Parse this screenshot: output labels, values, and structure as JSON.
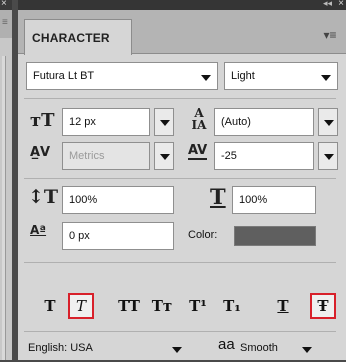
{
  "panel": {
    "tab_label": "CHARACTER",
    "collapse_glyph": "◂◂",
    "close_glyph": "×",
    "menu_glyph": "▾≡"
  },
  "font": {
    "family": "Futura Lt BT",
    "style": "Light"
  },
  "size": {
    "value": "12 px",
    "leading": "(Auto)"
  },
  "kerning": {
    "value": "Metrics",
    "tracking": "-25"
  },
  "scale": {
    "vertical": "100%",
    "horizontal": "100%"
  },
  "baseline": {
    "shift": "0 px",
    "color_label": "Color:"
  },
  "style_buttons": [
    {
      "glyph": "T",
      "name": "faux-bold",
      "selected": false
    },
    {
      "glyph": "T",
      "name": "faux-italic",
      "selected": true
    },
    {
      "glyph": "TT",
      "name": "all-caps",
      "selected": false
    },
    {
      "glyph": "Tт",
      "name": "small-caps",
      "selected": false
    },
    {
      "glyph": "T¹",
      "name": "superscript",
      "selected": false
    },
    {
      "glyph": "T₁",
      "name": "subscript",
      "selected": false
    },
    {
      "glyph": "T",
      "name": "underline",
      "selected": false
    },
    {
      "glyph": "Ŧ",
      "name": "strikethrough",
      "selected": true
    }
  ],
  "language": {
    "value": "English: USA",
    "aa_glyph": "aa",
    "antialias": "Smooth"
  },
  "colors": {
    "selection_outline": "#d8202a",
    "text_color_swatch": "#5f5f5f"
  }
}
